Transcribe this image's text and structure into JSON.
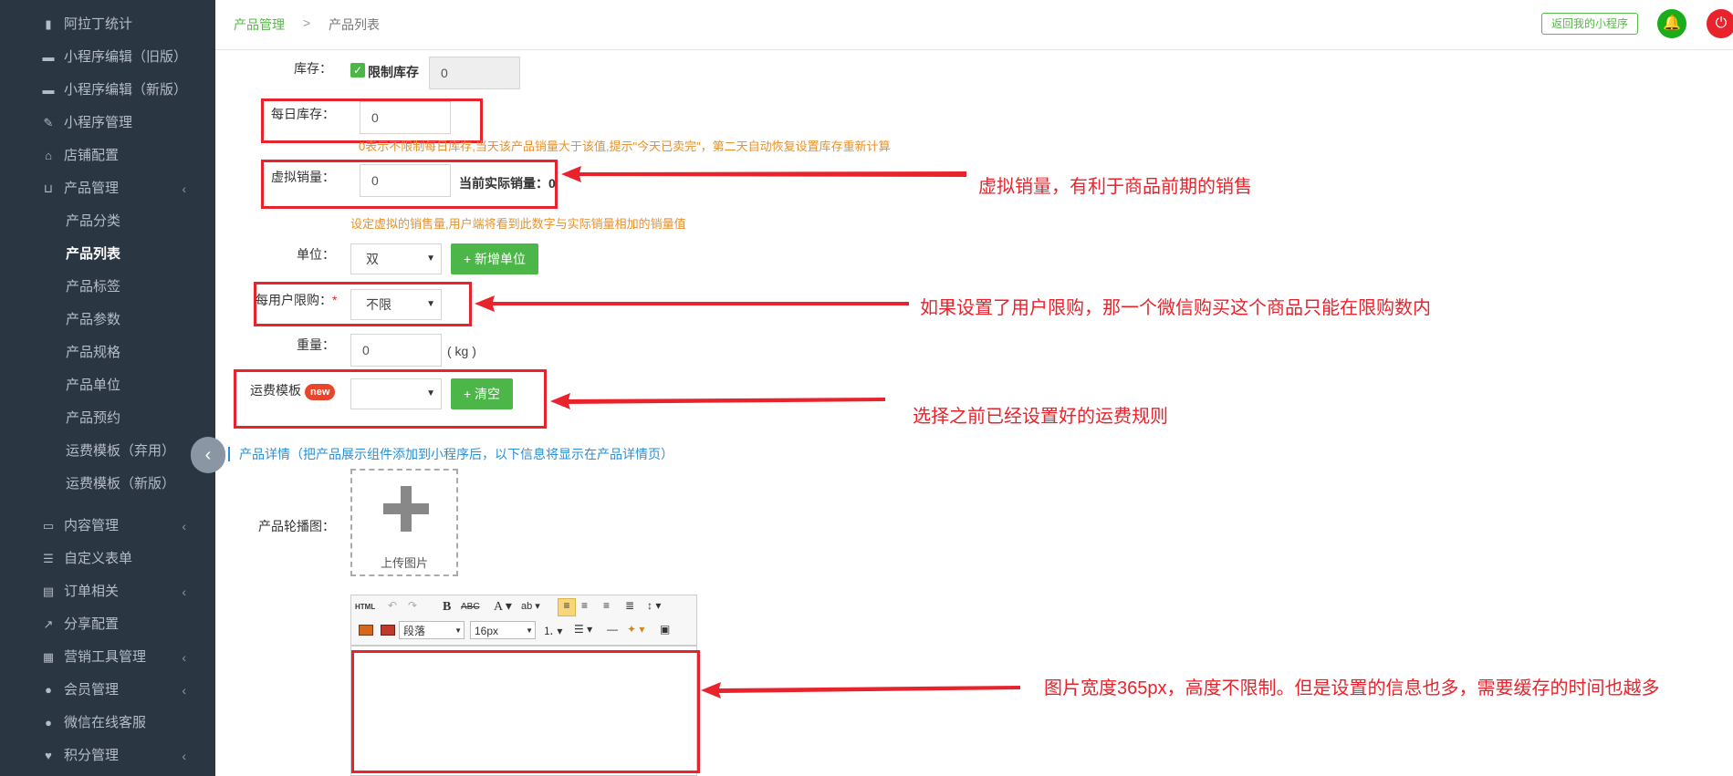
{
  "sidebar": {
    "items": [
      {
        "label": "阿拉丁统计",
        "icon": "bar-chart-icon"
      },
      {
        "label": "小程序编辑（旧版）",
        "icon": "book-icon"
      },
      {
        "label": "小程序编辑（新版）",
        "icon": "book-icon"
      },
      {
        "label": "小程序管理",
        "icon": "wrench-icon"
      },
      {
        "label": "店铺配置",
        "icon": "home-icon"
      },
      {
        "label": "产品管理",
        "icon": "cart-icon"
      },
      {
        "label": "内容管理",
        "icon": "folder-icon"
      },
      {
        "label": "自定义表单",
        "icon": "list-icon"
      },
      {
        "label": "订单相关",
        "icon": "book-icon"
      },
      {
        "label": "分享配置",
        "icon": "share-icon"
      },
      {
        "label": "营销工具管理",
        "icon": "grid-icon"
      },
      {
        "label": "会员管理",
        "icon": "user-icon"
      },
      {
        "label": "微信在线客服",
        "icon": "user-icon"
      },
      {
        "label": "积分管理",
        "icon": "heart-icon"
      }
    ],
    "product_sub": [
      "产品分类",
      "产品列表",
      "产品标签",
      "产品参数",
      "产品规格",
      "产品单位",
      "产品预约",
      "运费模板（弃用）",
      "运费模板（新版）"
    ],
    "active_sub": "产品列表"
  },
  "breadcrumb": {
    "parent": "产品管理",
    "sep": ">",
    "current": "产品列表"
  },
  "header": {
    "back_button": "返回我的小程序",
    "colors": {
      "bell": "#1aac19",
      "power": "#e8232c"
    }
  },
  "form": {
    "stock": {
      "label": "库存：",
      "checkbox_label": "限制库存",
      "checked": true,
      "value": "0"
    },
    "daily_stock": {
      "label": "每日库存：",
      "value": "0",
      "hint": "0表示不限制每日库存,当天该产品销量大于该值,提示\"今天已卖完\"，第二天自动恢复设置库存重新计算"
    },
    "virtual_sales": {
      "label": "虚拟销量：",
      "value": "0",
      "actual_label": "当前实际销量：0",
      "hint": "设定虚拟的销售量,用户端将看到此数字与实际销量相加的销量值"
    },
    "unit": {
      "label": "单位：",
      "selected": "双",
      "add_button": "+ 新增单位"
    },
    "user_limit": {
      "label": "每用户限购：",
      "required_mark": "*",
      "selected": "不限"
    },
    "weight": {
      "label": "重量：",
      "value": "0",
      "unit": "( kg )"
    },
    "shipping": {
      "label": "运费模板",
      "badge": "new",
      "selected": "",
      "clear_button": "+ 清空"
    }
  },
  "section_title": "产品详情（把产品展示组件添加到小程序后，以下信息将显示在产品详情页）",
  "carousel": {
    "label": "产品轮播图：",
    "upload_label": "上传图片"
  },
  "editor": {
    "paragraph_select": "段落",
    "font_size_select": "16px",
    "html_label": "HTML"
  },
  "annotations": {
    "virtual_sales": "虚拟销量，有利于商品前期的销售",
    "user_limit": "如果设置了用户限购，那一个微信购买这个商品只能在限购数内",
    "shipping": "选择之前已经设置好的运费规则",
    "editor": "图片宽度365px，高度不限制。但是设置的信息也多，需要缓存的时间也越多"
  },
  "colors": {
    "sidebar_bg": "#2b3643",
    "accent_green": "#4cb748",
    "annotation_red": "#e8232c",
    "hint_orange": "#e8902a",
    "section_blue": "#2a8fd6"
  }
}
